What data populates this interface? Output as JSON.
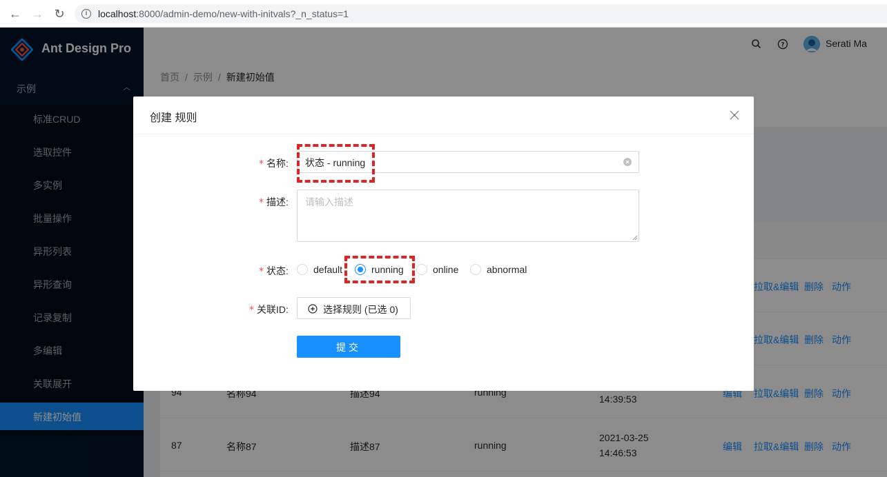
{
  "browser": {
    "url_host": "localhost",
    "url_rest": ":8000/admin-demo/new-with-initvals?_n_status=1"
  },
  "sidebar": {
    "brand": "Ant Design Pro",
    "group_label": "示例",
    "items": [
      {
        "label": "标准CRUD"
      },
      {
        "label": "选取控件"
      },
      {
        "label": "多实例"
      },
      {
        "label": "批量操作"
      },
      {
        "label": "异形列表"
      },
      {
        "label": "异形查询"
      },
      {
        "label": "记录复制"
      },
      {
        "label": "多编辑"
      },
      {
        "label": "关联展开"
      },
      {
        "label": "新建初始值"
      }
    ],
    "active_index": 9
  },
  "header": {
    "user_name": "Serati Ma"
  },
  "breadcrumb": {
    "items": [
      "首页",
      "示例",
      "新建初始值"
    ],
    "separator": "/"
  },
  "table": {
    "rows": [
      {
        "id": "94",
        "name": "名称94",
        "desc": "描述94",
        "status": "running",
        "time_line2": "14:39:53",
        "actions": [
          "编辑",
          "拉取&编辑",
          "删除",
          "动作"
        ]
      },
      {
        "id": "87",
        "name": "名称87",
        "desc": "描述87",
        "status": "running",
        "time_line1": "2021-03-25",
        "time_line2": "14:46:53",
        "actions": [
          "编辑",
          "拉取&编辑",
          "删除",
          "动作"
        ]
      }
    ],
    "partial_actions": [
      "拉取&编辑",
      "删除",
      "动作"
    ]
  },
  "modal": {
    "title": "创建 规则",
    "fields": {
      "name": {
        "label": "名称",
        "value": "状态 - running"
      },
      "desc": {
        "label": "描述",
        "placeholder": "请输入描述"
      },
      "status": {
        "label": "状态",
        "options": [
          "default",
          "running",
          "online",
          "abnormal"
        ],
        "selected": "running"
      },
      "related": {
        "label": "关联ID",
        "button": "选择规则 (已选 0)"
      }
    },
    "submit_label": "提交"
  },
  "colors": {
    "primary": "#1890ff",
    "sidebar_bg": "#001529",
    "required": "#ff4d4f",
    "highlight": "#e02424"
  }
}
